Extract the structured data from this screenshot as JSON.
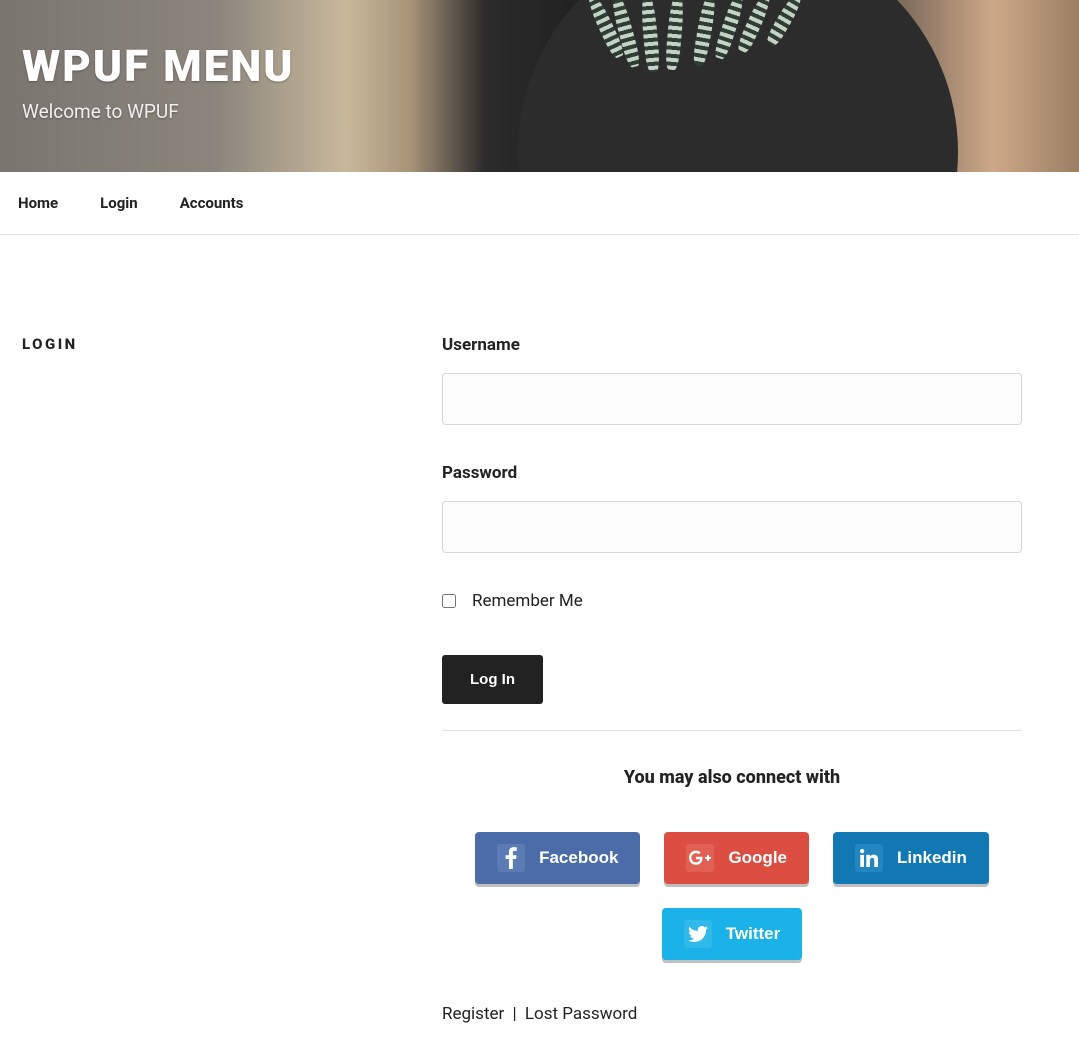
{
  "hero": {
    "title": "WPUF MENU",
    "tagline": "Welcome to WPUF"
  },
  "nav": {
    "items": [
      {
        "label": "Home"
      },
      {
        "label": "Login"
      },
      {
        "label": "Accounts"
      }
    ]
  },
  "sidebar": {
    "heading": "LOGIN"
  },
  "form": {
    "username_label": "Username",
    "password_label": "Password",
    "remember_label": "Remember Me",
    "submit_label": "Log In"
  },
  "social": {
    "heading": "You may also connect with",
    "buttons": {
      "facebook": "Facebook",
      "google": "Google",
      "linkedin": "Linkedin",
      "twitter": "Twitter"
    }
  },
  "links": {
    "register": "Register",
    "separator": "|",
    "lost_password": "Lost Password"
  }
}
